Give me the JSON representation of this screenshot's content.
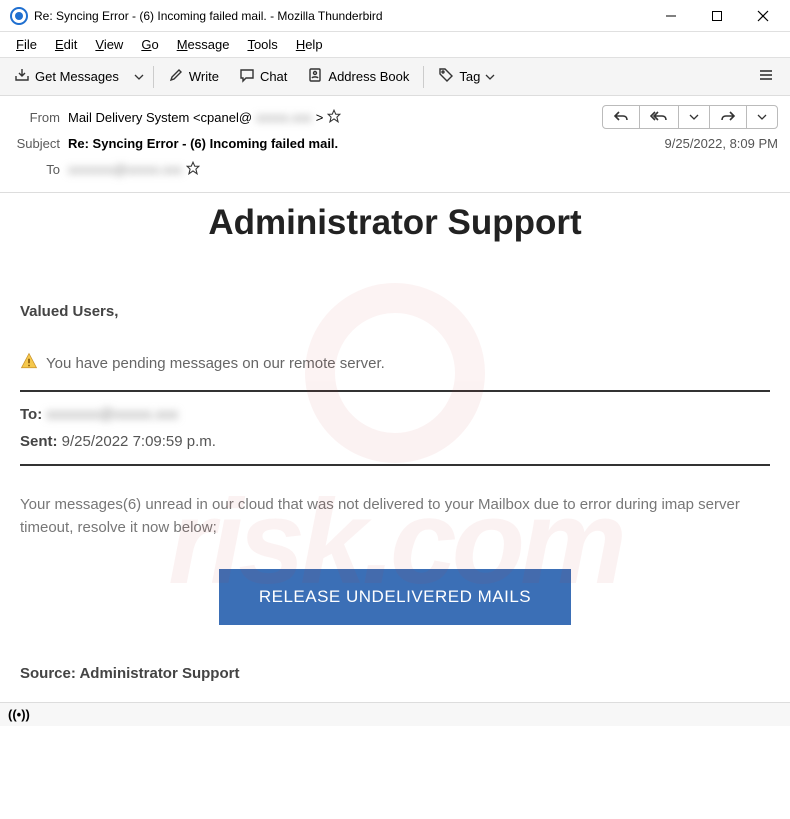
{
  "window": {
    "title": "Re: Syncing Error - (6) Incoming failed mail. - Mozilla Thunderbird"
  },
  "menu": {
    "file": "File",
    "edit": "Edit",
    "view": "View",
    "go": "Go",
    "message": "Message",
    "tools": "Tools",
    "help": "Help"
  },
  "toolbar": {
    "get_messages": "Get Messages",
    "write": "Write",
    "chat": "Chat",
    "address_book": "Address Book",
    "tag": "Tag"
  },
  "header": {
    "from_label": "From",
    "from_value": "Mail Delivery System <cpanel@",
    "from_blur": "xxxxx.xxx",
    "from_close": ">",
    "subject_label": "Subject",
    "subject_value": "Re: Syncing Error - (6) Incoming failed mail.",
    "to_label": "To",
    "to_blur": "xxxxxxx@xxxxx.xxx",
    "date": "9/25/2022, 8:09 PM"
  },
  "body": {
    "title": "Administrator Support",
    "valued": "Valued Users,",
    "pending": "You have pending messages on our remote server.",
    "to_label": "To:",
    "to_blur": "xxxxxxx@xxxxx.xxx",
    "sent_label": "Sent:",
    "sent_value": " 9/25/2022 7:09:59 p.m.",
    "message": "Your messages(6) unread in our cloud that was not delivered to your Mailbox due to error during imap server timeout, resolve it now below;",
    "button": "RELEASE UNDELIVERED MAILS",
    "source_label": "Source: ",
    "source_value": "Administrator Support"
  }
}
